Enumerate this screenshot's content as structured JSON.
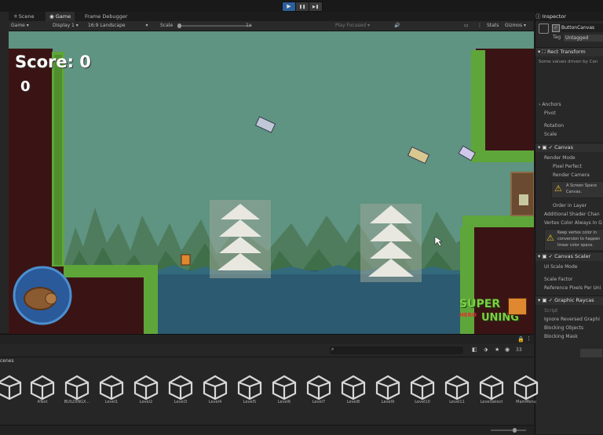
{
  "toolbar_play": {
    "play_icon": "▶",
    "pause_icon": "❚❚",
    "step_icon": "▶❚"
  },
  "tabs": [
    {
      "label": "Scene"
    },
    {
      "label": "Game"
    },
    {
      "label": "Frame Debugger"
    }
  ],
  "game_toolbar": {
    "display_mode": "Game",
    "display": "Display 1",
    "aspect": "16:9 Landscape",
    "scale_label": "Scale",
    "scale_value": "1x",
    "play_focused": "Play Focused",
    "stats": "Stats",
    "gizmos": "Gizmos"
  },
  "hud": {
    "score_label": "Score: 0",
    "counter": "0"
  },
  "game_logo": {
    "line1": "SUPER",
    "line2": "HERO",
    "line3": "UNING"
  },
  "inspector": {
    "title": "Inspector",
    "object_name": "ButtonCanvas",
    "tag_label": "Tag",
    "tag_value": "Untagged",
    "rect_transform": "Rect Transform",
    "rect_note": "Some values driven by Can",
    "anchors": "Anchors",
    "pivot": "Pivot",
    "rotation": "Rotation",
    "scale": "Scale",
    "canvas": "Canvas",
    "render_mode": "Render Mode",
    "pixel_perfect": "Pixel Perfect",
    "render_camera": "Render Camera",
    "warn1a": "A Screen Space",
    "warn1b": "Canvas.",
    "order_in_layer": "Order in Layer",
    "additional_shader": "Additional Shader Chan",
    "vertex_color": "Vertex Color Always In G",
    "warn2a": "Keep vertex color in",
    "warn2b": "conversion to happen",
    "warn2c": "linear color space.",
    "canvas_scaler": "Canvas Scaler",
    "ui_scale_mode": "UI Scale Mode",
    "scale_factor": "Scale Factor",
    "ref_pixels": "Reference Pixels Per Uni",
    "graphic_raycaster": "Graphic Raycas",
    "script": "Script",
    "ignore_reversed": "Ignore Reversed Graphi",
    "blocking_objects": "Blocking Objects",
    "blocking_mask": "Blocking Mask"
  },
  "project": {
    "header": "cenes",
    "count": "33",
    "assets": [
      {
        "name": ""
      },
      {
        "name": "ATest"
      },
      {
        "name": "BUILDINGX..."
      },
      {
        "name": "Level1"
      },
      {
        "name": "Level2"
      },
      {
        "name": "Level3"
      },
      {
        "name": "Level4"
      },
      {
        "name": "Level5"
      },
      {
        "name": "Level6"
      },
      {
        "name": "Level7"
      },
      {
        "name": "Level8"
      },
      {
        "name": "Level9"
      },
      {
        "name": "Level10"
      },
      {
        "name": "Level11"
      },
      {
        "name": "LevelSelect"
      },
      {
        "name": "MainMenu"
      }
    ]
  },
  "colors": {
    "sky": "#5f9382",
    "grass": "#5fa63a",
    "dirt": "#3a1414",
    "water": "#2c5a70",
    "play_blue": "#2b5f9b"
  }
}
